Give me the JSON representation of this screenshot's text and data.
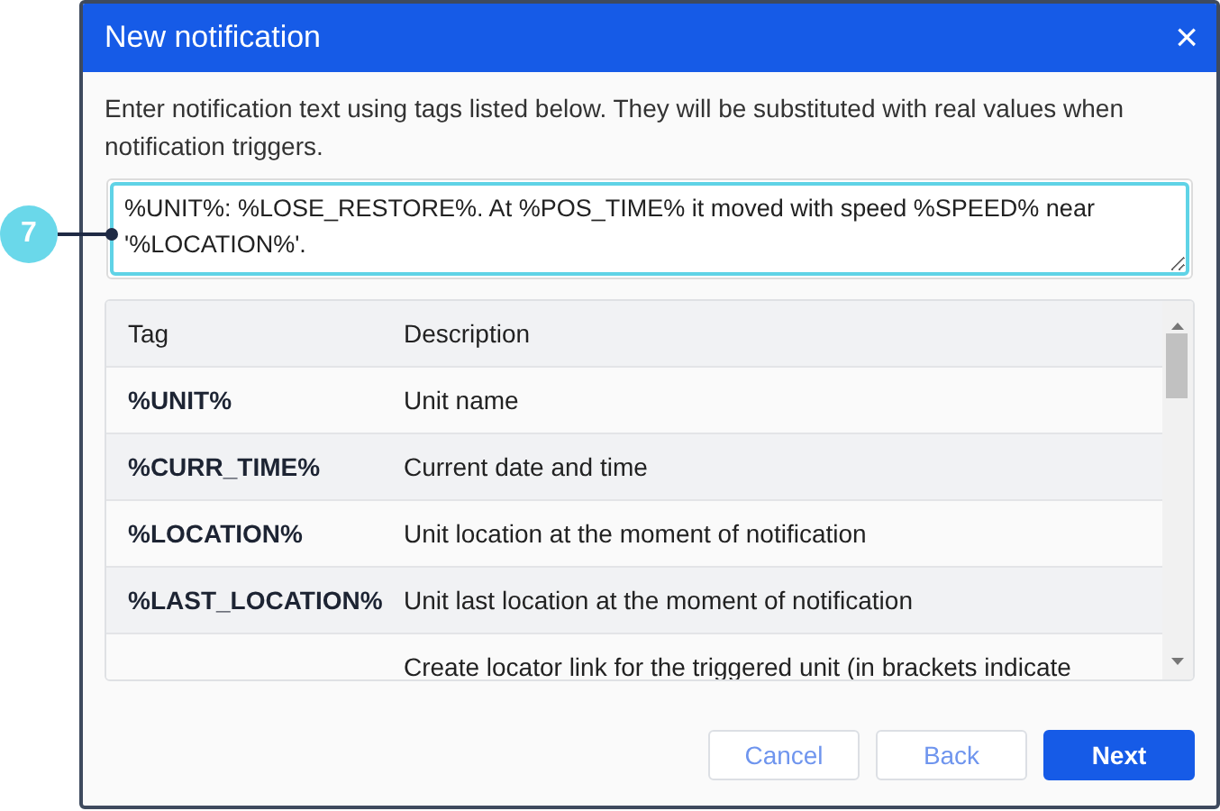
{
  "callout": {
    "number": "7"
  },
  "dialog": {
    "title": "New notification",
    "close": "×",
    "intro": "Enter notification text using tags listed below. They will be substituted with real values when notification triggers.",
    "text_field": {
      "value": "%UNIT%: %LOSE_RESTORE%. At %POS_TIME% it moved with speed %SPEED% near '%LOCATION%'."
    },
    "table": {
      "columns": [
        "Tag",
        "Description"
      ],
      "rows": [
        {
          "tag": "%UNIT%",
          "description": "Unit name"
        },
        {
          "tag": "%CURR_TIME%",
          "description": "Current date and time"
        },
        {
          "tag": "%LOCATION%",
          "description": "Unit location at the moment of notification"
        },
        {
          "tag": "%LAST_LOCATION%",
          "description": "Unit last location at the moment of notification"
        },
        {
          "description": "Create locator link for the triggered unit (in brackets indicate"
        }
      ]
    },
    "buttons": [
      {
        "label": "Cancel",
        "kind": "secondary"
      },
      {
        "label": "Back",
        "kind": "secondary"
      },
      {
        "label": "Next",
        "kind": "primary"
      }
    ]
  }
}
